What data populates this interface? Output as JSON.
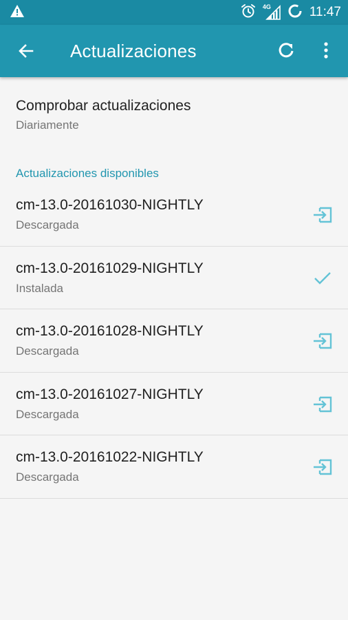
{
  "status_bar": {
    "time": "11:47",
    "network_type": "4G",
    "icons": [
      "warning-icon",
      "alarm-icon",
      "signal-icon",
      "battery-icon"
    ]
  },
  "app_bar": {
    "title": "Actualizaciones",
    "icons": [
      "back-arrow-icon",
      "refresh-icon",
      "more-vert-icon"
    ]
  },
  "check_updates": {
    "title": "Comprobar actualizaciones",
    "frequency": "Diariamente"
  },
  "available_updates": {
    "header": "Actualizaciones disponibles",
    "items": [
      {
        "name": "cm-13.0-20161030-NIGHTLY",
        "status": "Descargada",
        "action_icon": "install-icon"
      },
      {
        "name": "cm-13.0-20161029-NIGHTLY",
        "status": "Instalada",
        "action_icon": "check-icon"
      },
      {
        "name": "cm-13.0-20161028-NIGHTLY",
        "status": "Descargada",
        "action_icon": "install-icon"
      },
      {
        "name": "cm-13.0-20161027-NIGHTLY",
        "status": "Descargada",
        "action_icon": "install-icon"
      },
      {
        "name": "cm-13.0-20161022-NIGHTLY",
        "status": "Descargada",
        "action_icon": "install-icon"
      }
    ]
  },
  "colors": {
    "status_bar": "#1a8aa3",
    "app_bar": "#2196af",
    "accent": "#2196af",
    "action_icon": "#63c3d6"
  }
}
